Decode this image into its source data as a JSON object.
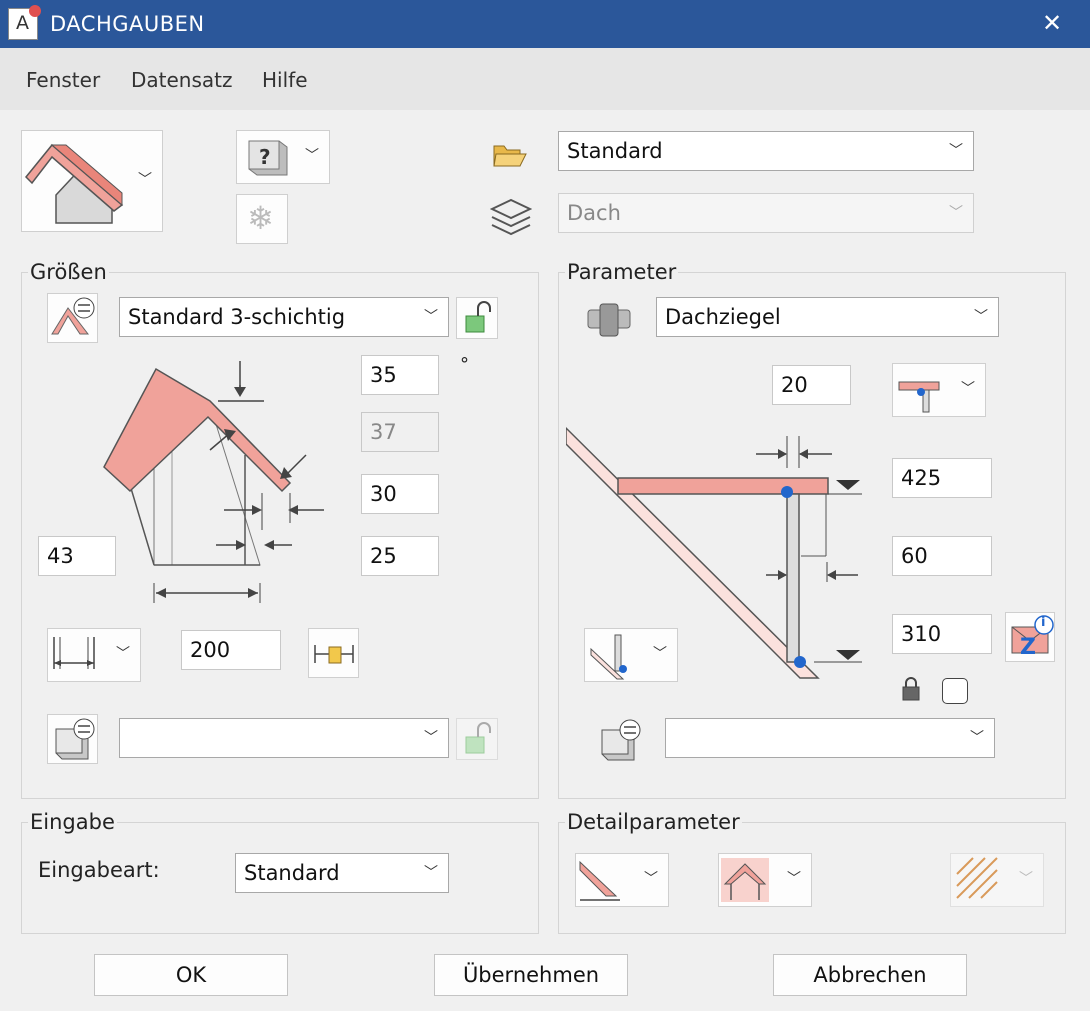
{
  "window": {
    "title": "DACHGAUBEN",
    "close": "✕",
    "app_icon_letter": "A"
  },
  "menu": {
    "items": [
      "Fenster",
      "Datensatz",
      "Hilfe"
    ]
  },
  "top": {
    "dataset": {
      "value": "Standard"
    },
    "layer": {
      "value": "Dach"
    },
    "help_glyph": "?",
    "freeze_glyph": "❄"
  },
  "groessen": {
    "title": "Größen",
    "structure": {
      "value": "Standard 3-schichtig"
    },
    "angle": "35",
    "angle_unit": "°",
    "angle2": "37",
    "v30": "30",
    "v25": "25",
    "v43": "43",
    "width": "200",
    "second_select": ""
  },
  "parameter": {
    "title": "Parameter",
    "material": {
      "value": "Dachziegel"
    },
    "v20": "20",
    "v425": "425",
    "v60": "60",
    "v310": "310",
    "z_letter": "Z",
    "info_letter": "i",
    "second_select": ""
  },
  "eingabe": {
    "title": "Eingabe",
    "label": "Eingabeart:",
    "value": "Standard"
  },
  "detail": {
    "title": "Detailparameter"
  },
  "buttons": {
    "ok": "OK",
    "apply": "Übernehmen",
    "cancel": "Abbrechen"
  },
  "chevron": "﹀",
  "colors": {
    "titlebar": "#2b579a",
    "roof": "#f0a29a",
    "blue_point": "#2266cc"
  }
}
